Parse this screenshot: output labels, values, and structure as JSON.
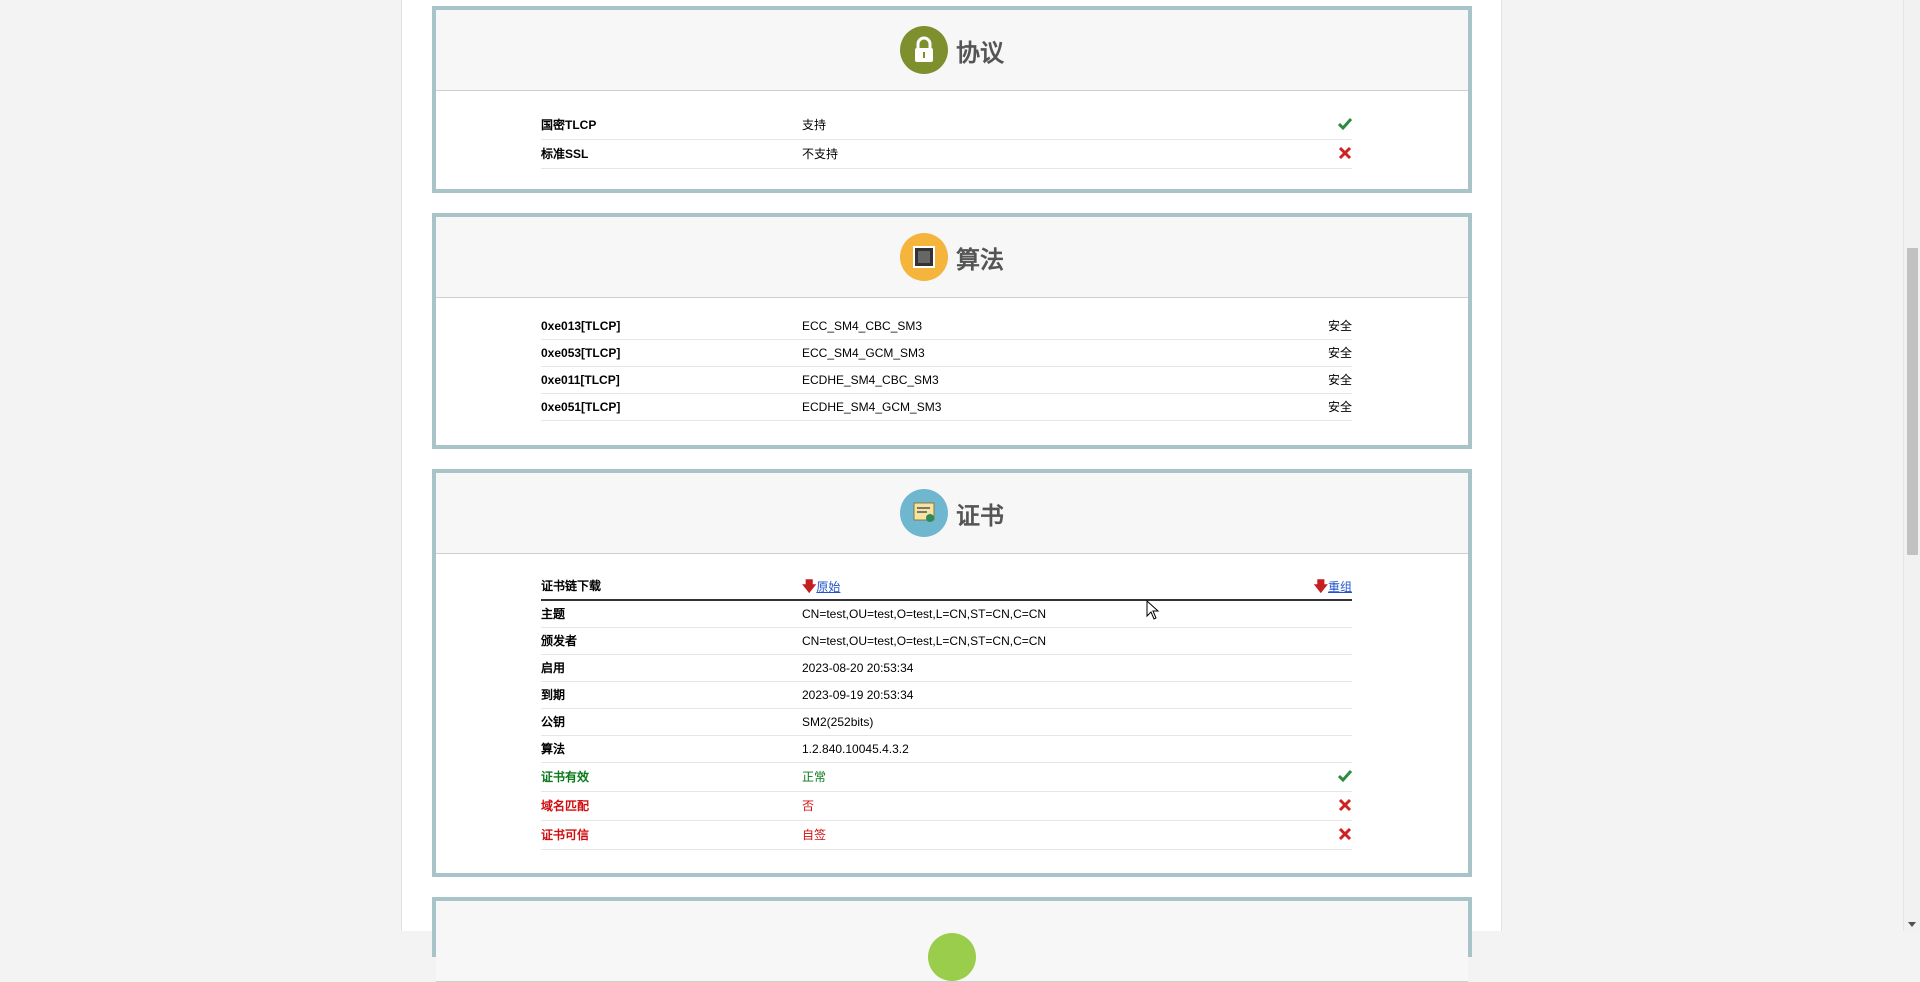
{
  "protocol": {
    "title": "协议",
    "rows": [
      {
        "name": "国密TLCP",
        "value": "支持",
        "status": "ok"
      },
      {
        "name": "标准SSL",
        "value": "不支持",
        "status": "bad"
      }
    ]
  },
  "algorithm": {
    "title": "算法",
    "rows": [
      {
        "code": "0xe013[TLCP]",
        "suite": "ECC_SM4_CBC_SM3",
        "level": "安全"
      },
      {
        "code": "0xe053[TLCP]",
        "suite": "ECC_SM4_GCM_SM3",
        "level": "安全"
      },
      {
        "code": "0xe011[TLCP]",
        "suite": "ECDHE_SM4_CBC_SM3",
        "level": "安全"
      },
      {
        "code": "0xe051[TLCP]",
        "suite": "ECDHE_SM4_GCM_SM3",
        "level": "安全"
      }
    ]
  },
  "certificate": {
    "title": "证书",
    "download_label": "证书链下载",
    "download_original": "原始",
    "download_rebuild": "重组",
    "rows": [
      {
        "name": "主题",
        "value": "CN=test,OU=test,O=test,L=CN,ST=CN,C=CN"
      },
      {
        "name": "颁发者",
        "value": "CN=test,OU=test,O=test,L=CN,ST=CN,C=CN"
      },
      {
        "name": "启用",
        "value": "2023-08-20 20:53:34"
      },
      {
        "name": "到期",
        "value": "2023-09-19 20:53:34"
      },
      {
        "name": "公钥",
        "value": "SM2(252bits)"
      },
      {
        "name": "算法",
        "value": "1.2.840.10045.4.3.2"
      }
    ],
    "checks": [
      {
        "name": "证书有效",
        "value": "正常",
        "status": "ok"
      },
      {
        "name": "域名匹配",
        "value": "否",
        "status": "bad"
      },
      {
        "name": "证书可信",
        "value": "自签",
        "status": "bad"
      }
    ]
  },
  "colors": {
    "panel_border": "#a9c4c9",
    "protocol_icon": "#7e8f2e",
    "algorithm_icon": "#f5b43c",
    "certificate_icon": "#6fb6cf",
    "ok": "#2e8b3c",
    "bad": "#d21f1f"
  }
}
